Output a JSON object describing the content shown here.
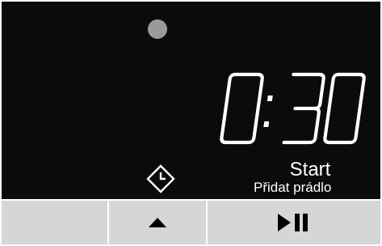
{
  "display": {
    "time": "0:30",
    "start_label": "Start",
    "add_laundry_label": "Přidat prádlo"
  },
  "icons": {
    "indicator": "status-dot",
    "delay": "delay-timer-clock-icon",
    "up": "up-arrow-icon",
    "play_pause": "play-pause-icon"
  },
  "colors": {
    "display_bg": "#0b0b0b",
    "text": "#ffffff",
    "indicator": "#9a9a9a",
    "button_bg": "#d6d6d6",
    "button_icon": "#000000"
  }
}
